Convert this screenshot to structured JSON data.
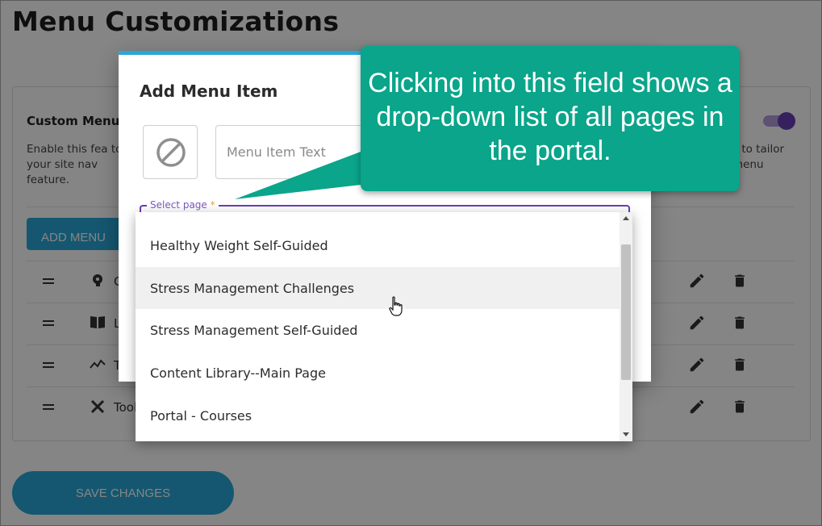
{
  "page": {
    "title": "Menu Customizations"
  },
  "card": {
    "heading": "Custom Menu",
    "description_left": "Enable this fea to your site nav feature.",
    "description_right": "s to tailor menu",
    "toggle_state": "on",
    "add_button_label": "ADD MENU",
    "rows": [
      {
        "icon": "brain-icon",
        "label": "C"
      },
      {
        "icon": "book-icon",
        "label": "L"
      },
      {
        "icon": "trend-icon",
        "label": "T"
      },
      {
        "icon": "tools-icon",
        "label": "Tool"
      }
    ],
    "save_button_label": "SAVE CHANGES"
  },
  "dialog": {
    "title": "Add Menu Item",
    "icon_picker": "none-icon",
    "menu_item_text_placeholder": "Menu Item Text",
    "select_label": "Select page",
    "select_required_mark": "*"
  },
  "dropdown": {
    "options": [
      "Healthy Weight Self-Guided",
      "Stress Management Challenges",
      "Stress Management Self-Guided",
      "Content Library--Main Page",
      "Portal - Courses"
    ],
    "hovered_index": 1
  },
  "callout": {
    "text": "Clicking into this field shows a drop-down list of all pages in the portal.",
    "color": "#0aa58a"
  },
  "colors": {
    "primary_button": "#2aa7d7",
    "accent_purple": "#6a3fb5"
  }
}
